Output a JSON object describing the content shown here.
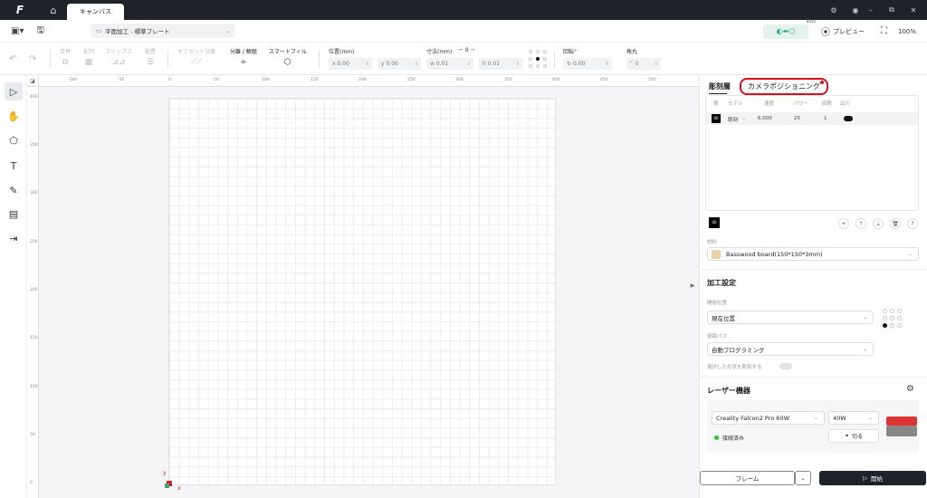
{
  "titlebar": {
    "logo": "F",
    "home_icon": "home-icon",
    "doc_tab": "キャンバス",
    "controls": [
      "gear-icon",
      "account-icon",
      "minimize-icon",
      "restore-icon",
      "close-icon"
    ]
  },
  "toolbar": {
    "process_select": "平面加工 - 標準プレート",
    "beta": "Beta",
    "preview": "プレビュー",
    "zoom": "100%"
  },
  "edit_tools": {
    "merge": "合併",
    "arrange": "配列",
    "flip": "フリップス",
    "align": "配置",
    "offset": "オフセット効果",
    "split": "分離 / 解組",
    "smart_fill": "スマートフィル"
  },
  "transform": {
    "position_label": "位置(mm)",
    "x_value": "x 0.00",
    "y_value": "y 0.00",
    "size_label": "寸法(mm)",
    "w_value": "w 0.01",
    "h_value": "h 0.01",
    "rotation_label": "回転°",
    "rotation_value": "0.00",
    "radius_label": "角丸",
    "radius_value": "0"
  },
  "rulers": {
    "top": [
      "-100",
      "-50",
      "0",
      "50",
      "100",
      "150",
      "200",
      "250",
      "300",
      "350",
      "400",
      "450",
      "500"
    ],
    "left": [
      "400",
      "350",
      "300",
      "250",
      "200",
      "150",
      "100",
      "50",
      "0"
    ]
  },
  "canvas": {
    "axis_x": "x",
    "axis_y": "y"
  },
  "panel": {
    "tab_layers": "彫刻層",
    "tab_camera": "カメラポジショニング",
    "layer_headers": [
      "層",
      "モデル",
      "速度",
      "パワー",
      "回数",
      "出力"
    ],
    "layer_row": {
      "swatch": "00",
      "mode": "彫刻",
      "speed": "6,000",
      "power": "25",
      "passes": "1"
    },
    "layer_swatch": "00",
    "material_label": "材料",
    "material_value": "Basswood board(150*150*3mm)",
    "processing_title": "加工設定",
    "start_pos_label": "開始位置",
    "start_pos_value": "現在位置",
    "path_label": "経路パス",
    "path_value": "自動プログラミング",
    "selected_only_label": "選択した形状を彫刻する",
    "laser_title": "レーザー機器",
    "device_name": "Creality Falcon2 Pro 60W",
    "power_value": "40W",
    "status": "接続済み",
    "disconnect": "切る",
    "frame_button": "フレーム",
    "start_button": "開始"
  }
}
